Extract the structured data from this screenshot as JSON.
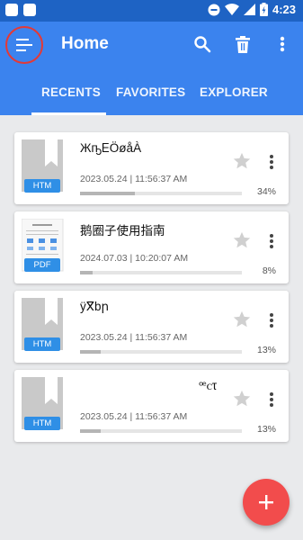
{
  "status_bar": {
    "time": "4:23"
  },
  "app_bar": {
    "title": "Home",
    "tabs": [
      {
        "label": "RECENTS",
        "active": true
      },
      {
        "label": "FAVORITES",
        "active": false
      },
      {
        "label": "EXPLORER",
        "active": false
      }
    ]
  },
  "files": [
    {
      "name": "ЖҧᎬÖøåÀ",
      "type": "HTM",
      "date": "2023.05.24 | 11:56:37 AM",
      "progress": 0.34,
      "percent": "34%",
      "favorite": false
    },
    {
      "name": "鹅圈子使用指南",
      "type": "PDF",
      "date": "2024.07.03 | 10:20:07 AM",
      "progress": 0.08,
      "percent": "8%",
      "favorite": false
    },
    {
      "name": "ÿⴳbր",
      "type": "HTM",
      "date": "2023.05.24 | 11:56:37 AM",
      "progress": 0.13,
      "percent": "13%",
      "favorite": false
    },
    {
      "name": "ꟹꮯτ",
      "type": "HTM",
      "date": "2023.05.24 | 11:56:37 AM",
      "progress": 0.13,
      "percent": "13%",
      "favorite": false
    }
  ],
  "colors": {
    "primary": "#3b83ee",
    "status_bar": "#1e63c4",
    "fab": "#f24c4c",
    "badge": "#2f8fe6"
  },
  "icons": [
    "menu-icon",
    "search-icon",
    "delete-icon",
    "more-vert-icon",
    "star-icon",
    "add-icon"
  ]
}
